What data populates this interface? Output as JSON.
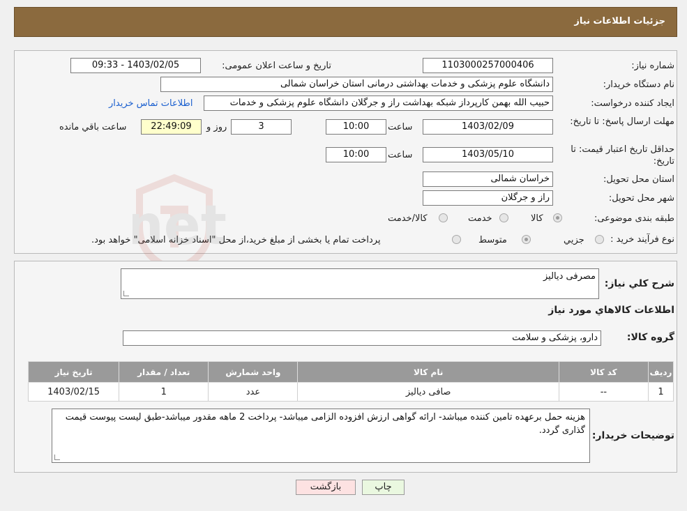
{
  "header": {
    "title": "جزئیات اطلاعات نیاز"
  },
  "form": {
    "need_number_label": "شماره نیاز:",
    "need_number": "1103000257000406",
    "announce_label": "تاریخ و ساعت اعلان عمومی:",
    "announce_value": "1403/02/05 - 09:33",
    "buyer_org_label": "نام دستگاه خریدار:",
    "buyer_org": "دانشگاه علوم پزشکی و خدمات بهداشتی درمانی استان خراسان شمالی",
    "creator_label": "ایجاد کننده درخواست:",
    "creator": "حبیب الله بهمن کارپرداز شبکه بهداشت راز و جرگلان دانشگاه علوم پزشکی و خدمات",
    "contact_link": "اطلاعات تماس خریدار",
    "deadline_label": "مهلت ارسال پاسخ: تا تاریخ:",
    "deadline_date": "1403/02/09",
    "time_label": "ساعت",
    "deadline_time": "10:00",
    "days_value": "3",
    "days_label": "روز و",
    "remaining_time": "22:49:09",
    "remaining_label": "ساعت باقي مانده",
    "validity_label": "حداقل تاریخ اعتبار قیمت: تا تاریخ:",
    "validity_date": "1403/05/10",
    "validity_time": "10:00",
    "province_label": "استان محل تحویل:",
    "province": "خراسان شمالی",
    "city_label": "شهر محل تحویل:",
    "city": "راز و جرگلان",
    "category_label": "طبقه بندی موضوعی:",
    "category_options": [
      "کالا",
      "خدمت",
      "کالا/خدمت"
    ],
    "process_label": "نوع فرآیند خرید :",
    "process_options": [
      "جزيي",
      "متوسط"
    ],
    "payment_note": "پرداخت تمام یا بخشی از مبلغ خرید،از محل \"اسناد خزانه اسلامی\" خواهد بود."
  },
  "details": {
    "summary_label": "شرح کلي نياز:",
    "summary": "مصرفی دیالیز",
    "items_heading": "اطلاعات کالاهاي مورد نياز",
    "group_label": "گروه کالا:",
    "group_value": "دارو، پزشکی و سلامت",
    "table": {
      "headers": [
        "رديف",
        "کد کالا",
        "نام کالا",
        "واحد شمارش",
        "تعداد / مقدار",
        "تاریخ نیاز"
      ],
      "rows": [
        [
          "1",
          "--",
          "صافی دیالیز",
          "عدد",
          "1",
          "1403/02/15"
        ]
      ]
    },
    "buyer_notes_label": "توضیحات خریدار:",
    "buyer_notes": "هزینه حمل برعهده تامین کننده میباشد- ارائه گواهی ارزش افزوده الزامی میباشد- پرداخت 2 ماهه مقدور میباشد-طبق لیست پیوست قیمت گذاری گردد."
  },
  "buttons": {
    "print": "چاپ",
    "back": "بازگشت"
  },
  "watermark": {
    "brand": "AriaTender.net"
  }
}
